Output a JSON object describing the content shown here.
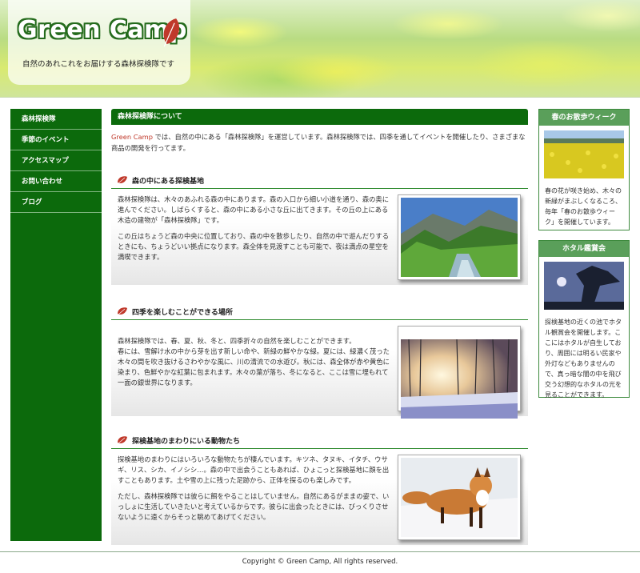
{
  "header": {
    "logo": "Green Camp",
    "tagline": "自然のあれこれをお届けする森林探検隊です"
  },
  "sidebar": {
    "items": [
      {
        "label": "森林探検隊"
      },
      {
        "label": "季節のイベント"
      },
      {
        "label": "アクセスマップ"
      },
      {
        "label": "お問い合わせ"
      },
      {
        "label": "ブログ"
      }
    ]
  },
  "main": {
    "title": "森林探検隊について",
    "intro_brand": "Green Camp",
    "intro_text": " では、自然の中にある「森林探検隊」を運営しています。森林探検隊では、四季を通してイベントを開催したり、さまざまな商品の開発を行ってます。",
    "sections": [
      {
        "heading": "森の中にある探検基地",
        "paragraphs": [
          "森林探検隊は、木々のあふれる森の中にあります。森の入口から細い小道を通り、森の奥に進んでください。しばらくすると、森の中にある小さな丘に出てきます。その丘の上にある木造の建物が「森林探検隊」です。",
          "この丘はちょうど森の中央に位置しており、森の中を散歩したり、自然の中で遊んだりするときにも、ちょうどいい拠点になります。森全体を見渡すことも可能で、夜は満点の星空を満喫できます。"
        ]
      },
      {
        "heading": "四季を楽しむことができる場所",
        "paragraphs": [
          "森林探検隊では、春、夏、秋、冬と、四季折々の自然を楽しむことができます。\n春には、雪解け水の中から芽を出す新しい命や、新緑の鮮やかな緑。夏には、緑濃く茂った木々の間を吹き抜けるさわやかな風に、川の清流での水遊び。秋には、森全体が赤や黄色に染まり、色鮮やかな紅葉に包まれます。木々の葉が落ち、冬になると、ここは雪に埋もれて一面の銀世界になります。"
        ]
      },
      {
        "heading": "探検基地のまわりにいる動物たち",
        "paragraphs": [
          "探検基地のまわりにはいろいろな動物たちが棲んでいます。キツネ、タヌキ、イタチ、ウサギ、リス、シカ、イノシシ…。森の中で出会うこともあれば、ひょこっと探検基地に顔を出すこともあります。土や雪の上に残った足跡から、正体を探るのも楽しみです。",
          "ただし、森林探検隊では彼らに餌をやることはしていません。自然にあるがままの姿で、いっしょに生活していきたいと考えているからです。彼らに出会ったときには、びっくりさせないように遠くからそっと眺めてあげてください。"
        ]
      }
    ]
  },
  "right": {
    "boxes": [
      {
        "title": "春のお散歩ウィーク",
        "text": "春の花が咲き始め、木々の新緑がまぶしくなるころ、毎年「春のお散歩ウィーク」を開催しています。"
      },
      {
        "title": "ホタル鑑賞会",
        "text": "探検基地の近くの池でホタル観賞会を開催します。ここにはホタルが自生しており、周囲には明るい民家や外灯などもありませんので、真っ暗な闇の中を飛び交う幻想的なホタルの光を見ることができます。"
      }
    ]
  },
  "footer": {
    "text": "Copyright © Green Camp, All rights reserved."
  },
  "colors": {
    "primary_green": "#0c6a0c",
    "accent_red": "#c0392b",
    "box_title_green": "#5a9f5a"
  }
}
